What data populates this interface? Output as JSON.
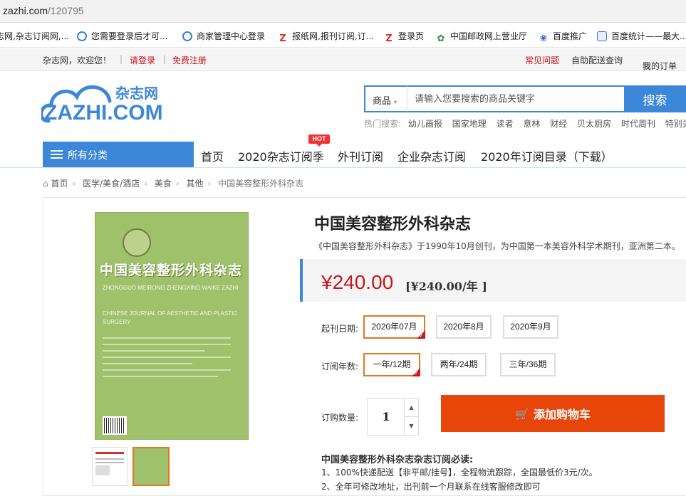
{
  "browser": {
    "url_host": "zazhi.com",
    "url_path": "/120795",
    "bookmarks": [
      {
        "label": "志网,杂志订阅网,...",
        "color": "#ffffff"
      },
      {
        "label": "您需要登录后才可...",
        "color": "#3d7fd0"
      },
      {
        "label": "商家管理中心登录",
        "color": "#3d7fd0"
      },
      {
        "label": "报纸网,报刊订阅,订...",
        "color": "#d9342b"
      },
      {
        "label": "登录页",
        "color": "#d9342b"
      },
      {
        "label": "中国邮政网上营业厅",
        "color": "#2e8b3e"
      },
      {
        "label": "百度推广",
        "color": "#2a63d4"
      },
      {
        "label": "百度统计——最大...",
        "color": "#3a6fd8"
      }
    ]
  },
  "topbar": {
    "welcome": "杂志网，欢迎您！",
    "login": "请登录",
    "register": "免费注册",
    "faq": "常见问题",
    "self_service": "自助配送查询",
    "my_orders": "我的订单"
  },
  "header": {
    "logo_cn": "杂志网",
    "logo_en": "ZAZHI.COM",
    "search_category": "商品",
    "search_placeholder": "请输入您要搜索的商品关键字",
    "search_button": "搜索",
    "hot_label": "热门搜索:",
    "hot_words": [
      "幼儿画报",
      "国家地理",
      "读者",
      "意林",
      "财经",
      "贝太厨房",
      "时代周刊",
      "特别关注"
    ]
  },
  "nav": {
    "all_categories": "所有分类",
    "links": [
      "首页",
      "2020杂志订阅季",
      "外刊订阅",
      "企业杂志订阅",
      "2020年订阅目录（下载）"
    ],
    "hot_badge": "HOT"
  },
  "breadcrumb": [
    "首页",
    "医学/美食/酒店",
    "美食",
    "其他",
    "中国美容整形外科杂志"
  ],
  "cover": {
    "title": "中国美容整形外科杂志",
    "pinyin": "ZHONGGUO MEIRONG ZHENGXING WAIKE ZAZHI",
    "english": "CHINESE JOURNAL OF AESTHETIC AND PLASTIC SURGERY"
  },
  "product": {
    "title": "中国美容整形外科杂志",
    "description": "《中国美容整形外科杂志》于1990年10月创刊，为中国第一本美容外科学术期刊，亚洲第二本。",
    "price": "¥240.00",
    "price_per_year": "[¥240.00/年 ]",
    "start_label": "起刊日期:",
    "start_options": [
      "2020年07月",
      "2020年8月",
      "2020年9月"
    ],
    "period_label": "订阅年数:",
    "period_options": [
      "一年/12期",
      "两年/24期",
      "三年/36期"
    ],
    "qty_label": "订购数量:",
    "qty_value": "1",
    "cart_button": "添加购物车",
    "notice_title": "中国美容整形外科杂志杂志订阅必读:",
    "notice_1": "1、100%快递配送【非平邮/挂号】，全程物流跟踪，全国最低价3元/次。",
    "notice_2": "2、全年可修改地址，出刊前一个月联系在线客服修改即可"
  }
}
